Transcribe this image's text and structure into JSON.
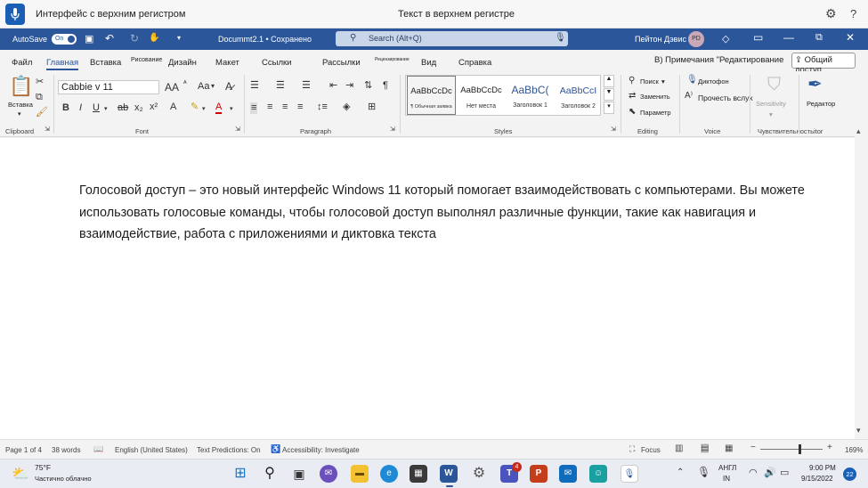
{
  "voice_access": {
    "title": "Интерфейс с верхним регистром",
    "center_text": "Текст в верхнем регистре"
  },
  "titlebar": {
    "autosave_label": "AutoSave",
    "autosave_state": "On",
    "doc_name": "Docummt2.1 • Сохранено",
    "search_placeholder": "Search (Alt+Q)",
    "user_name": "Пейтон Дэвис",
    "user_initials": "PD"
  },
  "tabs": [
    "Файл",
    "Главная",
    "Вставка",
    "Рисование",
    "Дизайн",
    "Макет",
    "Ссылки",
    "Рассылки",
    "Рецензирование",
    "Вид",
    "Справка"
  ],
  "tab_right": {
    "comments": "B) Примечания",
    "editing": "\"Редактирование",
    "share": "Общий доступ"
  },
  "ribbon": {
    "paste_label": "Вставка",
    "font_name": "Cabbie v 11",
    "styles": [
      {
        "preview": "AaBbCcDc",
        "name": "¶ Обычная заявка"
      },
      {
        "preview": "AaBbCcDc",
        "name": "Нет места"
      },
      {
        "preview": "AaBbC(",
        "name": "Заголовок 1"
      },
      {
        "preview": "AaBbCcI",
        "name": "Заголовок 2"
      }
    ],
    "editing_items": [
      "Поиск",
      "Заменить",
      "Параметр"
    ],
    "voice_items": [
      "Диктофон",
      "Прочесть вслух"
    ],
    "sensitivity_label": "Sensitivity",
    "editor_label": "Редактор",
    "group_labels": {
      "clipboard": "Clipboard",
      "font": "Font",
      "paragraph": "Paragraph",
      "styles": "Styles",
      "editing": "Editing",
      "voice": "Voice",
      "sensitivity": "Чувствительность",
      "editor": "itor"
    }
  },
  "document": {
    "body": "Голосовой доступ – это новый интерфейс Windows 11 который помогает взаимодействовать с компьютерами. Вы можете использовать голосовые команды, чтобы голосовой доступ выполнял различные функции, такие как навигация и взаимодействие, работа с приложениями и диктовка текста"
  },
  "statusbar": {
    "page": "Page 1 of 4",
    "words": "38 words",
    "language": "English (United States)",
    "predictions": "Text Predictions: On",
    "accessibility": "Accessibility: Investigate",
    "focus": "Focus",
    "zoom": "169%"
  },
  "taskbar": {
    "temp": "75°F",
    "weather": "Частично облачно",
    "lang_top": "АНГЛ",
    "lang_bottom": "IN",
    "time": "9:00 PM",
    "date": "9/15/2022",
    "notifications": "22",
    "teams_badge": "4"
  },
  "colors": {
    "word_blue": "#2b579a",
    "voice_blue": "#1a5fb4"
  }
}
